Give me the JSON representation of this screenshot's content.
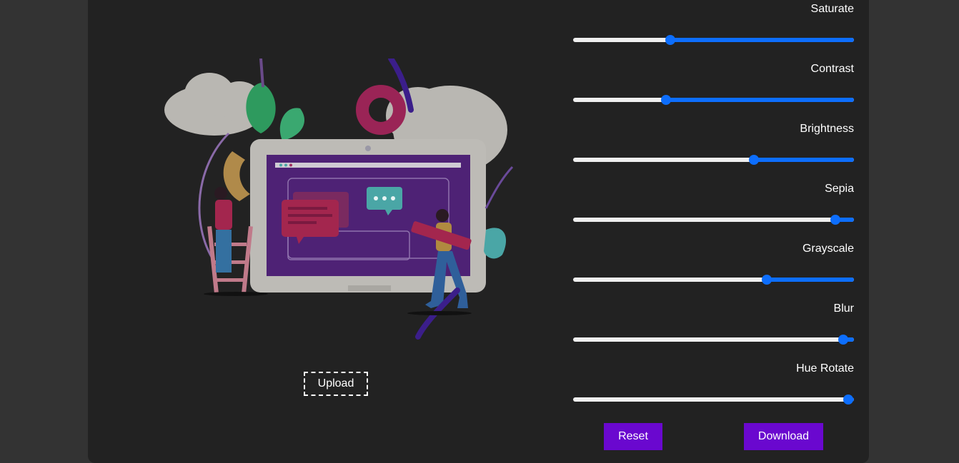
{
  "filters": [
    {
      "label": "Saturate",
      "value": 0.345
    },
    {
      "label": "Contrast",
      "value": 0.33
    },
    {
      "label": "Brightness",
      "value": 0.645
    },
    {
      "label": "Sepia",
      "value": 0.935
    },
    {
      "label": "Grayscale",
      "value": 0.69
    },
    {
      "label": "Blur",
      "value": 0.963
    },
    {
      "label": "Hue Rotate",
      "value": 0.98
    }
  ],
  "upload_label": "Upload",
  "reset_label": "Reset",
  "download_label": "Download",
  "colors": {
    "page_bg": "#333333",
    "panel_bg": "#222222",
    "accent": "#0d6efd",
    "button_bg": "#6a08cf"
  }
}
